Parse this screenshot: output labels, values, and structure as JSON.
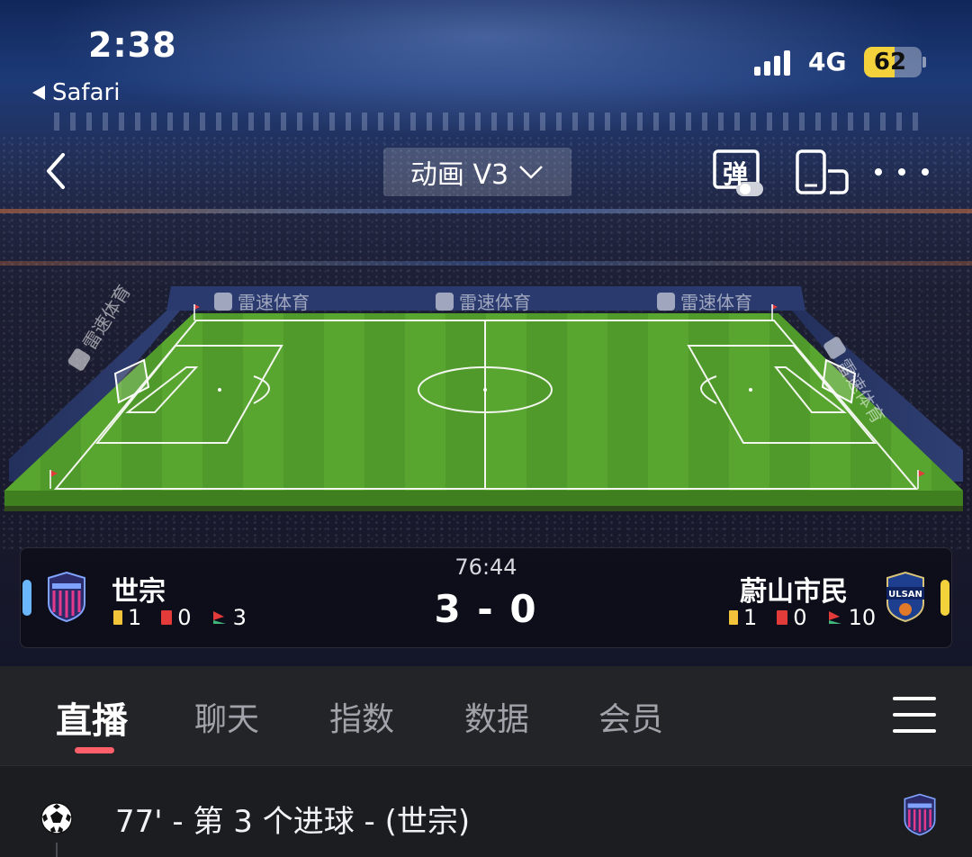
{
  "status_bar": {
    "time": "2:38",
    "back_app": "Safari",
    "network": "4G",
    "battery_percent": 62
  },
  "nav": {
    "mode_label": "动画 V3",
    "danmu_icon_text": "弹",
    "icons": [
      "back-chevron-icon",
      "danmu-toggle-icon",
      "screen-rotate-icon",
      "more-icon"
    ]
  },
  "stadium": {
    "brand_text": "雷速体育"
  },
  "match": {
    "clock": "76:44",
    "score": "3 - 0",
    "home": {
      "name": "世宗",
      "yellow_cards": "1",
      "red_cards": "0",
      "corners": "3",
      "color": "#6ab6ff"
    },
    "away": {
      "name": "蔚山市民",
      "crest_text": "ULSAN",
      "yellow_cards": "1",
      "red_cards": "0",
      "corners": "10",
      "color": "#f3d23c"
    }
  },
  "tabs": {
    "items": [
      "直播",
      "聊天",
      "指数",
      "数据",
      "会员"
    ],
    "active": "直播",
    "accent": "#ff5f68"
  },
  "events": [
    {
      "text": "77' - 第 3 个进球 - (世宗)",
      "icon": "soccer-ball-icon"
    }
  ]
}
